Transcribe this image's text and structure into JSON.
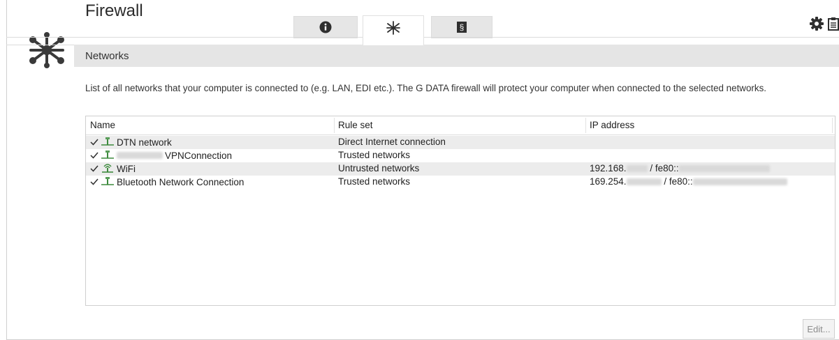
{
  "window": {
    "title": "Firewall"
  },
  "tabs": [
    {
      "name": "info",
      "icon": "info-icon",
      "active": false
    },
    {
      "name": "networks",
      "icon": "network-icon",
      "active": true
    },
    {
      "name": "legal",
      "label": "§",
      "active": false
    }
  ],
  "section": {
    "title": "Networks"
  },
  "description": "List of all networks that your computer is connected to (e.g. LAN, EDI etc.). The G DATA firewall will protect your computer when connected to the selected networks.",
  "table": {
    "columns": [
      "Name",
      "Rule set",
      "IP address"
    ],
    "rows": [
      {
        "checked": true,
        "icon": "wired-network-icon",
        "name": "DTN network",
        "rule_set": "Direct Internet connection",
        "ip": ""
      },
      {
        "checked": true,
        "icon": "wired-network-icon",
        "name": "VPNConnection",
        "rule_set": "Trusted networks",
        "ip": ""
      },
      {
        "checked": true,
        "icon": "wifi-network-icon",
        "name": "WiFi",
        "rule_set": "Untrusted networks",
        "ip_prefix": "192.168.",
        "ip_sep": " / fe80::"
      },
      {
        "checked": true,
        "icon": "wired-network-icon",
        "name": "Bluetooth Network Connection",
        "rule_set": "Trusted networks",
        "ip_prefix": "169.254.",
        "ip_sep": " / fe80::"
      }
    ]
  },
  "buttons": {
    "edit": "Edit..."
  },
  "colors": {
    "accent": "#3a3a3a",
    "section_bar": "#e5e5e5",
    "row_alt": "#ececec"
  }
}
